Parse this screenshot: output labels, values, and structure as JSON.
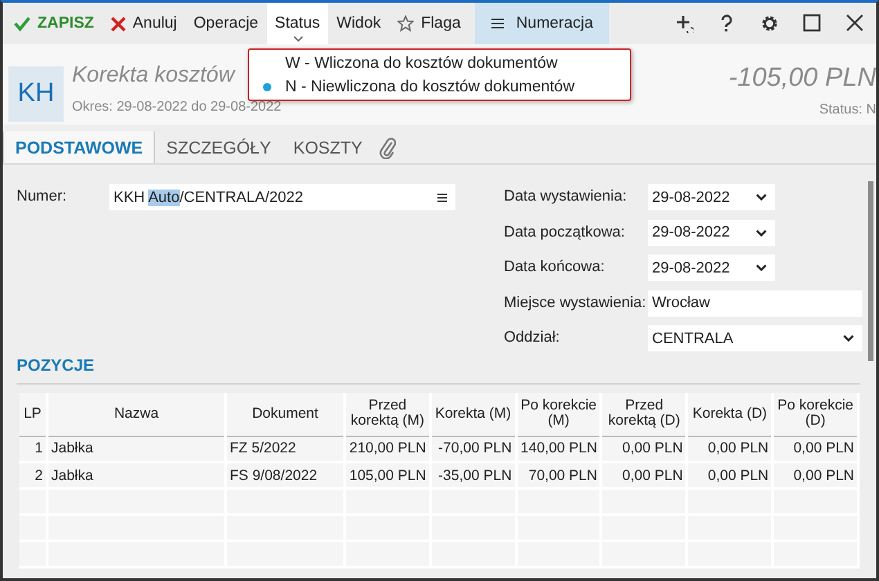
{
  "toolbar": {
    "items": [
      {
        "label": "ZAPISZ",
        "kind": "save",
        "selected": false
      },
      {
        "label": "Anuluj",
        "kind": "cancel",
        "selected": false
      },
      {
        "label": "Operacje",
        "kind": "plain",
        "selected": false
      },
      {
        "label": "Status",
        "kind": "plain",
        "selected": true
      },
      {
        "label": "Widok",
        "kind": "plain",
        "selected": false
      },
      {
        "label": "Flaga",
        "kind": "flag",
        "selected": false
      },
      {
        "label": "Numeracja",
        "kind": "numbering",
        "selected": false
      }
    ]
  },
  "status_menu": {
    "items": [
      {
        "label": "W - Wliczona do kosztów dokumentów",
        "selected": false
      },
      {
        "label": "N - Niewliczona do kosztów dokumentów",
        "selected": true
      }
    ]
  },
  "header": {
    "badge": "KH",
    "title": "Korekta kosztów",
    "period": "Okres: 29-08-2022 do 29-08-2022",
    "amount": "-105,00 PLN",
    "status": "Status: N"
  },
  "tabs": [
    {
      "label": "PODSTAWOWE",
      "selected": true
    },
    {
      "label": "SZCZEGÓŁY",
      "selected": false
    },
    {
      "label": "KOSZTY",
      "selected": false
    }
  ],
  "form": {
    "numer": {
      "label": "Numer:",
      "value_parts": [
        {
          "text": "KKH ",
          "selected": false
        },
        {
          "text": "Auto",
          "selected": true
        },
        {
          "text": "/CENTRALA/2022",
          "selected": false
        }
      ]
    },
    "fields": [
      {
        "label": "Data wystawienia:",
        "value": "29-08-2022",
        "kind": "date"
      },
      {
        "label": "Data początkowa:",
        "value": "29-08-2022",
        "kind": "date"
      },
      {
        "label": "Data końcowa:",
        "value": "29-08-2022",
        "kind": "date"
      },
      {
        "label": "Miejsce wystawienia:",
        "value": "Wrocław",
        "kind": "text"
      },
      {
        "label": "Oddział:",
        "value": "CENTRALA",
        "kind": "select"
      }
    ]
  },
  "positions": {
    "title": "POZYCJE",
    "columns": [
      "LP",
      "Nazwa",
      "Dokument",
      "Przed korektą (M)",
      "Korekta (M)",
      "Po korekcie (M)",
      "Przed korektą (D)",
      "Korekta (D)",
      "Po korekcie (D)"
    ],
    "rows": [
      [
        "1",
        "Jabłka",
        "FZ 5/2022",
        "210,00 PLN",
        "-70,00 PLN",
        "140,00 PLN",
        "0,00 PLN",
        "0,00 PLN",
        "0,00 PLN"
      ],
      [
        "2",
        "Jabłka",
        "FS 9/08/2022",
        "105,00 PLN",
        "-35,00 PLN",
        "70,00 PLN",
        "0,00 PLN",
        "0,00 PLN",
        "0,00 PLN"
      ]
    ]
  }
}
